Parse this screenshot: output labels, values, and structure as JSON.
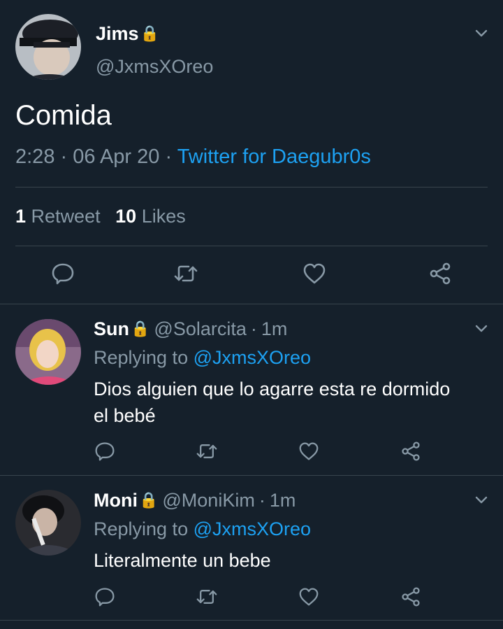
{
  "main_tweet": {
    "author_name": "Jims",
    "author_handle": "@JxmsXOreo",
    "lock_glyph": "🔒",
    "text": "Comida",
    "time": "2:28",
    "date": "06 Apr 20",
    "sep": "·",
    "source": "Twitter for Daegubr0s",
    "retweet_count": "1",
    "retweet_label": "Retweet",
    "likes_count": "10",
    "likes_label": "Likes"
  },
  "replies": [
    {
      "author_name": "Sun",
      "lock_glyph": "🔒",
      "author_handle": "@Solarcita",
      "time": "1m",
      "sep": "·",
      "replying_label": "Replying to",
      "replying_handle": "@JxmsXOreo",
      "text_line1": "Dios alguien que lo agarre esta re dormido",
      "text_line2": "el bebé"
    },
    {
      "author_name": "Moni",
      "lock_glyph": "🔒",
      "author_handle": "@MoniKim",
      "time": "1m",
      "sep": "·",
      "replying_label": "Replying to",
      "replying_handle": "@JxmsXOreo",
      "text_line1": "Literalmente un bebe"
    }
  ],
  "icons": {
    "reply": "reply-icon",
    "retweet": "retweet-icon",
    "like": "like-icon",
    "share": "share-icon",
    "more": "chevron-down-icon",
    "lock": "lock-icon"
  },
  "colors": {
    "background": "#15202b",
    "text": "#ffffff",
    "muted": "#8899a6",
    "link": "#1da1f2",
    "divider": "#38444d"
  }
}
